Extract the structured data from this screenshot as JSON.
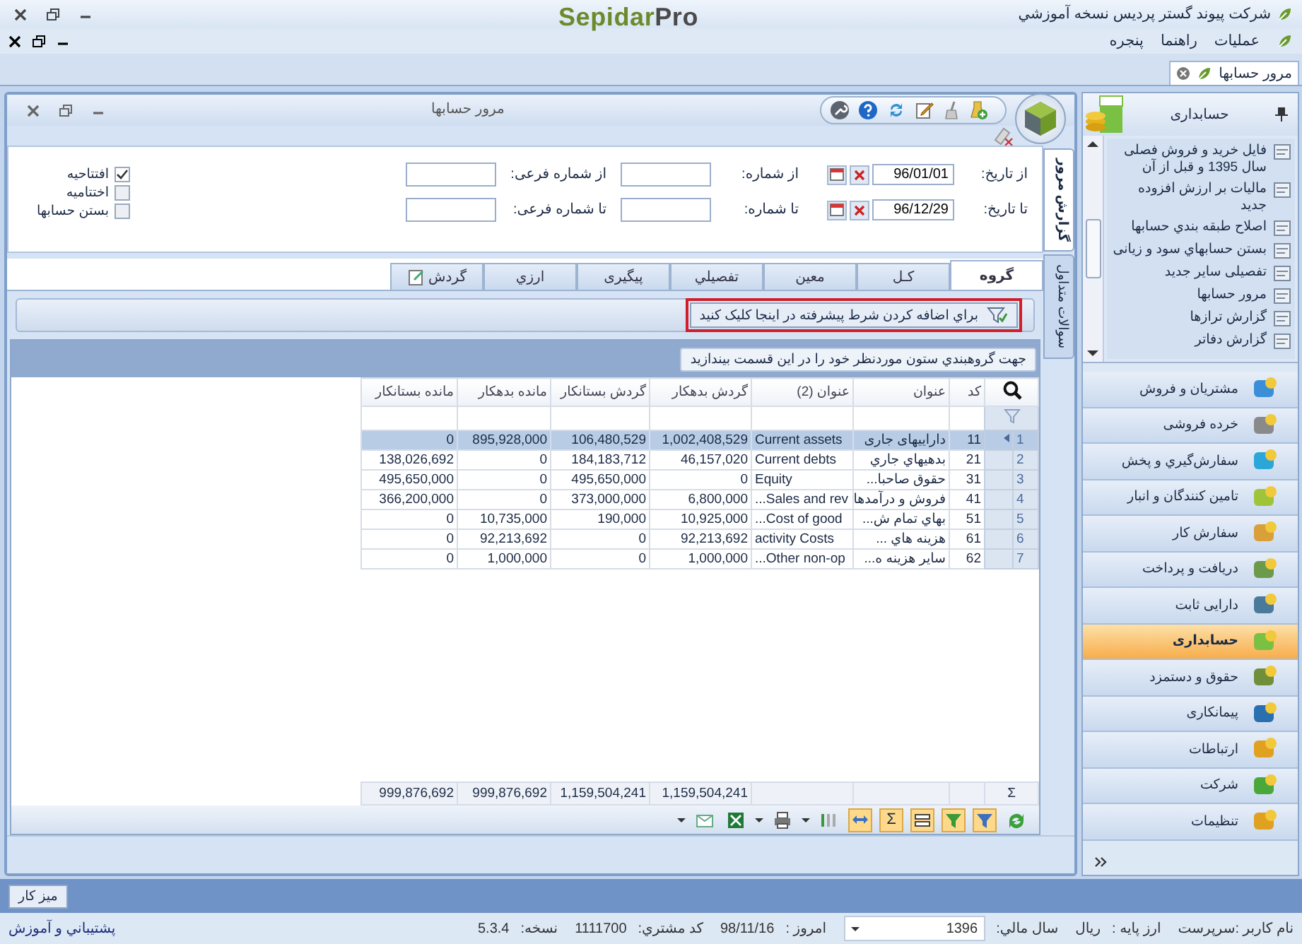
{
  "app": {
    "title": "شرکت پیوند گستر پردیس نسخه آموزشي",
    "logo": {
      "brand": "Sepidar",
      "suffix": "Pro"
    }
  },
  "menu": [
    {
      "label": "عملیات"
    },
    {
      "label": "راهنما"
    },
    {
      "label": "پنجره"
    }
  ],
  "doc_tabs": [
    {
      "label": "مرور حسابها",
      "selected": true
    }
  ],
  "window": {
    "title": "مرور حسابها"
  },
  "filter_rows": [
    {
      "date_label": "از تاریخ:",
      "date": "96/01/01",
      "number_label": "از شماره:",
      "sub_label": "از شماره فرعی:"
    },
    {
      "date_label": "تا تاریخ:",
      "date": "96/12/29",
      "number_label": "تا شماره:",
      "sub_label": "تا شماره فرعی:"
    }
  ],
  "options": [
    {
      "label": "افتتاحیه",
      "checked": true
    },
    {
      "label": "اختتامیه",
      "checked": false
    },
    {
      "label": "بستن حسابها",
      "checked": false
    }
  ],
  "side_tabs": [
    {
      "label": "گزارش مرور",
      "selected": true
    },
    {
      "label": "سوالات متداول",
      "selected": false
    }
  ],
  "tabs": [
    {
      "label": "گروه",
      "selected": true,
      "has_icon": false
    },
    {
      "label": "کـل",
      "selected": false,
      "has_icon": false
    },
    {
      "label": "معین",
      "selected": false,
      "has_icon": false
    },
    {
      "label": "تفصیلي",
      "selected": false,
      "has_icon": false
    },
    {
      "label": "پیگیری",
      "selected": false,
      "has_icon": false
    },
    {
      "label": "ارزي",
      "selected": false,
      "has_icon": false
    },
    {
      "label": "گردش",
      "selected": false,
      "has_icon": true
    }
  ],
  "advanced_filter": {
    "label": "براي اضافه کردن شرط پیشرفته در اینجا کلیک کنید",
    "highlighted": true
  },
  "group_panel": {
    "hint": "جهت گروهبندي ستون موردنظر خود را در این قسمت بیندازید"
  },
  "table": {
    "columns": [
      "کد",
      "عنوان",
      "عنوان (2)",
      "گردش بدهکار",
      "گردش بستانکار",
      "مانده بدهکار",
      "مانده بستانکار"
    ],
    "rows": [
      {
        "number": "1",
        "selected": true,
        "cells": [
          "11",
          "دارایيهای جاری",
          "Current assets",
          "1,002,408,529",
          "106,480,529",
          "895,928,000",
          "0"
        ]
      },
      {
        "number": "2",
        "selected": false,
        "cells": [
          "21",
          "بدهيهاي جاري",
          "Current debts",
          "46,157,020",
          "184,183,712",
          "0",
          "138,026,692"
        ]
      },
      {
        "number": "3",
        "selected": false,
        "cells": [
          "31",
          "حقوق صاحبا...",
          "Equity",
          "0",
          "495,650,000",
          "0",
          "495,650,000"
        ]
      },
      {
        "number": "4",
        "selected": false,
        "cells": [
          "41",
          "فروش و درآمدها",
          "Sales and rev...",
          "6,800,000",
          "373,000,000",
          "0",
          "366,200,000"
        ]
      },
      {
        "number": "5",
        "selected": false,
        "cells": [
          "51",
          "بهاي تمام ش...",
          "Cost of good...",
          "10,925,000",
          "190,000",
          "10,735,000",
          "0"
        ]
      },
      {
        "number": "6",
        "selected": false,
        "cells": [
          "61",
          "هزینه هاي ...",
          "activity Costs",
          "92,213,692",
          "0",
          "92,213,692",
          "0"
        ]
      },
      {
        "number": "7",
        "selected": false,
        "cells": [
          "62",
          "سایر هزینه ه...",
          "Other non-op...",
          "1,000,000",
          "0",
          "1,000,000",
          "0"
        ]
      }
    ],
    "footer_symbol": "Σ",
    "totals": [
      "1,159,504,241",
      "1,159,504,241",
      "999,876,692",
      "999,876,692"
    ]
  },
  "grid_toolbar": {
    "sum_symbol": "Σ"
  },
  "sidebar": {
    "title": "حسابداری",
    "items": [
      {
        "label": "فایل خرید و فروش فصلی سال 1395 و قبل از آن"
      },
      {
        "label": "مالیات بر ارزش افزوده جدید"
      },
      {
        "label": "اصلاح طبقه بندي حسابها"
      },
      {
        "label": "بستن حسابهاي سود و زیانی"
      },
      {
        "label": "تفصیلی سایر جدید"
      },
      {
        "label": "مرور حسابها"
      },
      {
        "label": "گزارش ترازها"
      },
      {
        "label": "گزارش دفاتر"
      }
    ],
    "modules": [
      {
        "label": "مشتریان و فروش",
        "selected": false
      },
      {
        "label": "خرده فروشی",
        "selected": false
      },
      {
        "label": "سفارش‌گیري و پخش",
        "selected": false
      },
      {
        "label": "تامین کنندگان و انبار",
        "selected": false
      },
      {
        "label": "سفارش کار",
        "selected": false
      },
      {
        "label": "دریافت و پرداخت",
        "selected": false
      },
      {
        "label": "دارایی ثابت",
        "selected": false
      },
      {
        "label": "حسابداری",
        "selected": true
      },
      {
        "label": "حقوق و دستمزد",
        "selected": false
      },
      {
        "label": "پیمانکاری",
        "selected": false
      },
      {
        "label": "ارتباطات",
        "selected": false
      },
      {
        "label": "شرکت",
        "selected": false
      },
      {
        "label": "تنظیمات",
        "selected": false
      }
    ]
  },
  "taskbar": {
    "button": "میز کار"
  },
  "status_bar": {
    "user": "نام کاربر :سرپرست",
    "fields": [
      {
        "label": "ارز پایه :",
        "value": "ریال",
        "kind": "text"
      },
      {
        "label": "سال مالي:",
        "value": "1396",
        "kind": "dropdown"
      },
      {
        "label": "امروز :",
        "value": "98/11/16",
        "kind": "text"
      },
      {
        "label": "کد مشتري:",
        "value": "1111700",
        "kind": "text"
      },
      {
        "label": "نسخه:",
        "value": "5.3.4",
        "kind": "text"
      }
    ],
    "support": "پشتیباني و آموزش"
  }
}
